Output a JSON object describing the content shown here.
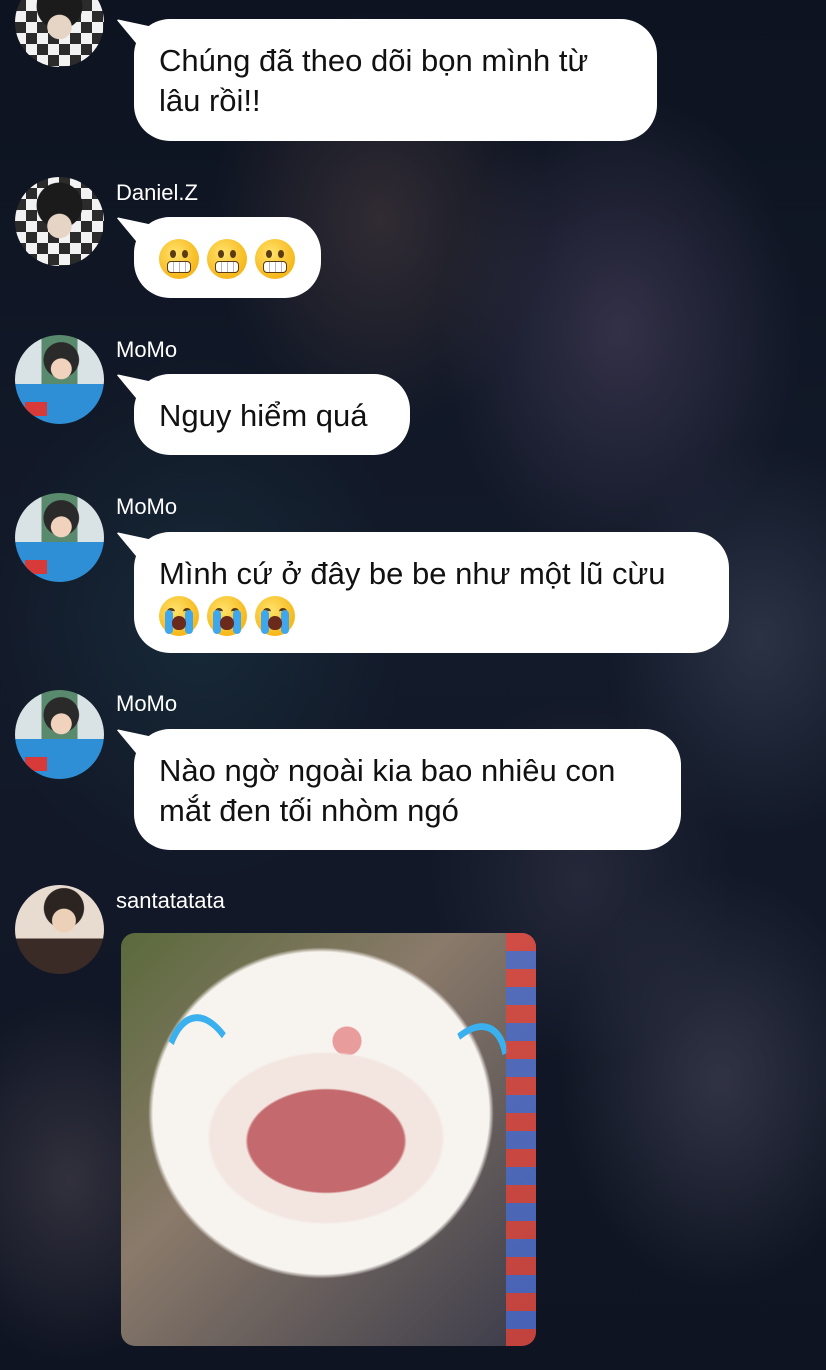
{
  "messages": [
    {
      "sender": "Daniel.Z",
      "lines": [
        "Chúng đã theo dõi bọn mình từ",
        "lâu rồi!!"
      ],
      "emojis": []
    },
    {
      "sender": "Daniel.Z",
      "lines": [],
      "emojis": [
        "grimacing-face",
        "grimacing-face",
        "grimacing-face"
      ]
    },
    {
      "sender": "MoMo",
      "lines": [
        "Nguy hiểm quá"
      ],
      "emojis": []
    },
    {
      "sender": "MoMo",
      "lines": [
        "Mình cứ ở đây be be như một lũ cừu"
      ],
      "emojis": [
        "loudly-crying-face",
        "loudly-crying-face",
        "loudly-crying-face"
      ]
    },
    {
      "sender": "MoMo",
      "lines": [
        "Nào ngờ ngoài kia bao nhiêu con",
        "mắt đen tối nhòm ngó"
      ],
      "emojis": []
    },
    {
      "sender": "santatatata",
      "image": "crying-cat-photo"
    }
  ]
}
